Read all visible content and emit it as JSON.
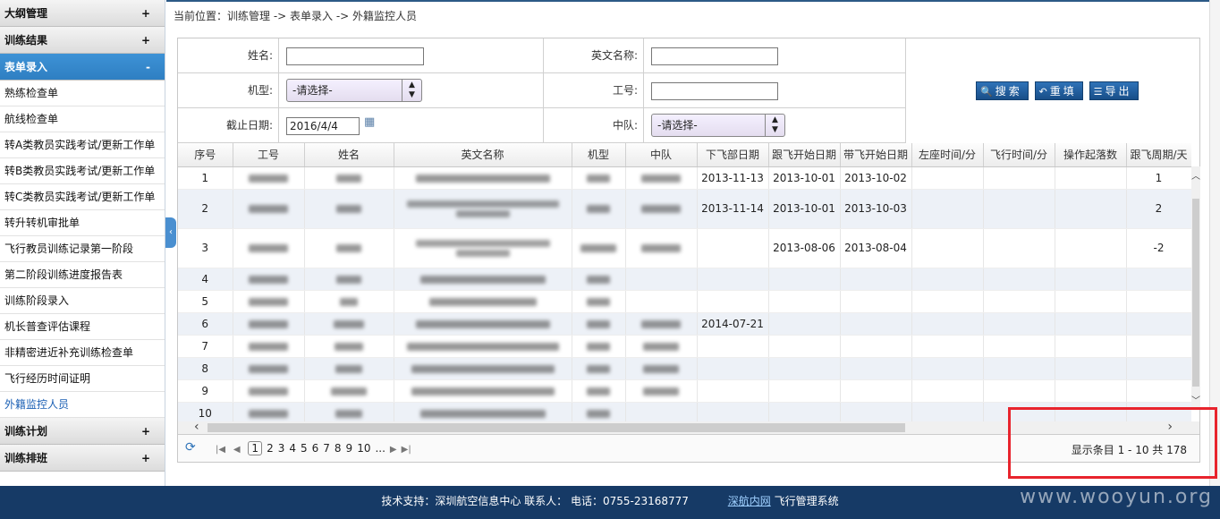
{
  "sidebar": {
    "groups_top": [
      {
        "label": "大纲管理",
        "sign": "+"
      },
      {
        "label": "训练结果",
        "sign": "+"
      },
      {
        "label": "表单录入",
        "sign": "-"
      }
    ],
    "items": [
      "熟练检查单",
      "航线检查单",
      "转A类教员实践考试/更新工作单",
      "转B类教员实践考试/更新工作单",
      "转C类教员实践考试/更新工作单",
      "转升转机审批单",
      "飞行教员训练记录第一阶段",
      "第二阶段训练进度报告表",
      "训练阶段录入",
      "机长普查评估课程",
      "非精密进近补充训练检查单",
      "飞行经历时间证明",
      "外籍监控人员"
    ],
    "groups_bottom": [
      {
        "label": "训练计划",
        "sign": "+"
      },
      {
        "label": "训练排班",
        "sign": "+"
      }
    ]
  },
  "breadcrumb": "当前位置：训练管理 -> 表单录入 -> 外籍监控人员",
  "form": {
    "name_label": "姓名:",
    "en_name_label": "英文名称:",
    "model_label": "机型:",
    "model_value": "-请选择-",
    "emp_no_label": "工号:",
    "deadline_label": "截止日期:",
    "deadline_value": "2016/4/4",
    "squadron_label": "中队:",
    "squadron_value": "-请选择-"
  },
  "buttons": {
    "search": "搜索",
    "reset": "重填",
    "export": "导出"
  },
  "table": {
    "columns": [
      "序号",
      "工号",
      "姓名",
      "英文名称",
      "机型",
      "中队",
      "下飞部日期",
      "跟飞开始日期",
      "带飞开始日期",
      "左座时间/分",
      "飞行时间/分",
      "操作起落数",
      "跟飞周期/天"
    ],
    "rows": [
      {
        "no": "1",
        "down": "2013-11-13",
        "follow": "2013-10-01",
        "lead": "2013-10-02",
        "cycle": "1"
      },
      {
        "no": "2",
        "down": "2013-11-14",
        "follow": "2013-10-01",
        "lead": "2013-10-03",
        "cycle": "2"
      },
      {
        "no": "3",
        "down": "",
        "follow": "2013-08-06",
        "lead": "2013-08-04",
        "cycle": "-2"
      },
      {
        "no": "4",
        "down": "",
        "follow": "",
        "lead": "",
        "cycle": ""
      },
      {
        "no": "5",
        "down": "",
        "follow": "",
        "lead": "",
        "cycle": ""
      },
      {
        "no": "6",
        "down": "2014-07-21",
        "follow": "",
        "lead": "",
        "cycle": ""
      },
      {
        "no": "7",
        "down": "",
        "follow": "",
        "lead": "",
        "cycle": ""
      },
      {
        "no": "8",
        "down": "",
        "follow": "",
        "lead": "",
        "cycle": ""
      },
      {
        "no": "9",
        "down": "",
        "follow": "",
        "lead": "",
        "cycle": ""
      },
      {
        "no": "10",
        "down": "",
        "follow": "",
        "lead": "",
        "cycle": ""
      }
    ]
  },
  "pager": {
    "pages": [
      "1",
      "2",
      "3",
      "4",
      "5",
      "6",
      "7",
      "8",
      "9",
      "10",
      "..."
    ],
    "info": "显示条目 1 - 10 共 178"
  },
  "footer": {
    "support": "技术支持：深圳航空信息中心 联系人： 电话：0755-23168777",
    "link": "深航内网",
    "system": "飞行管理系统"
  },
  "watermark": "www.wooyun.org"
}
